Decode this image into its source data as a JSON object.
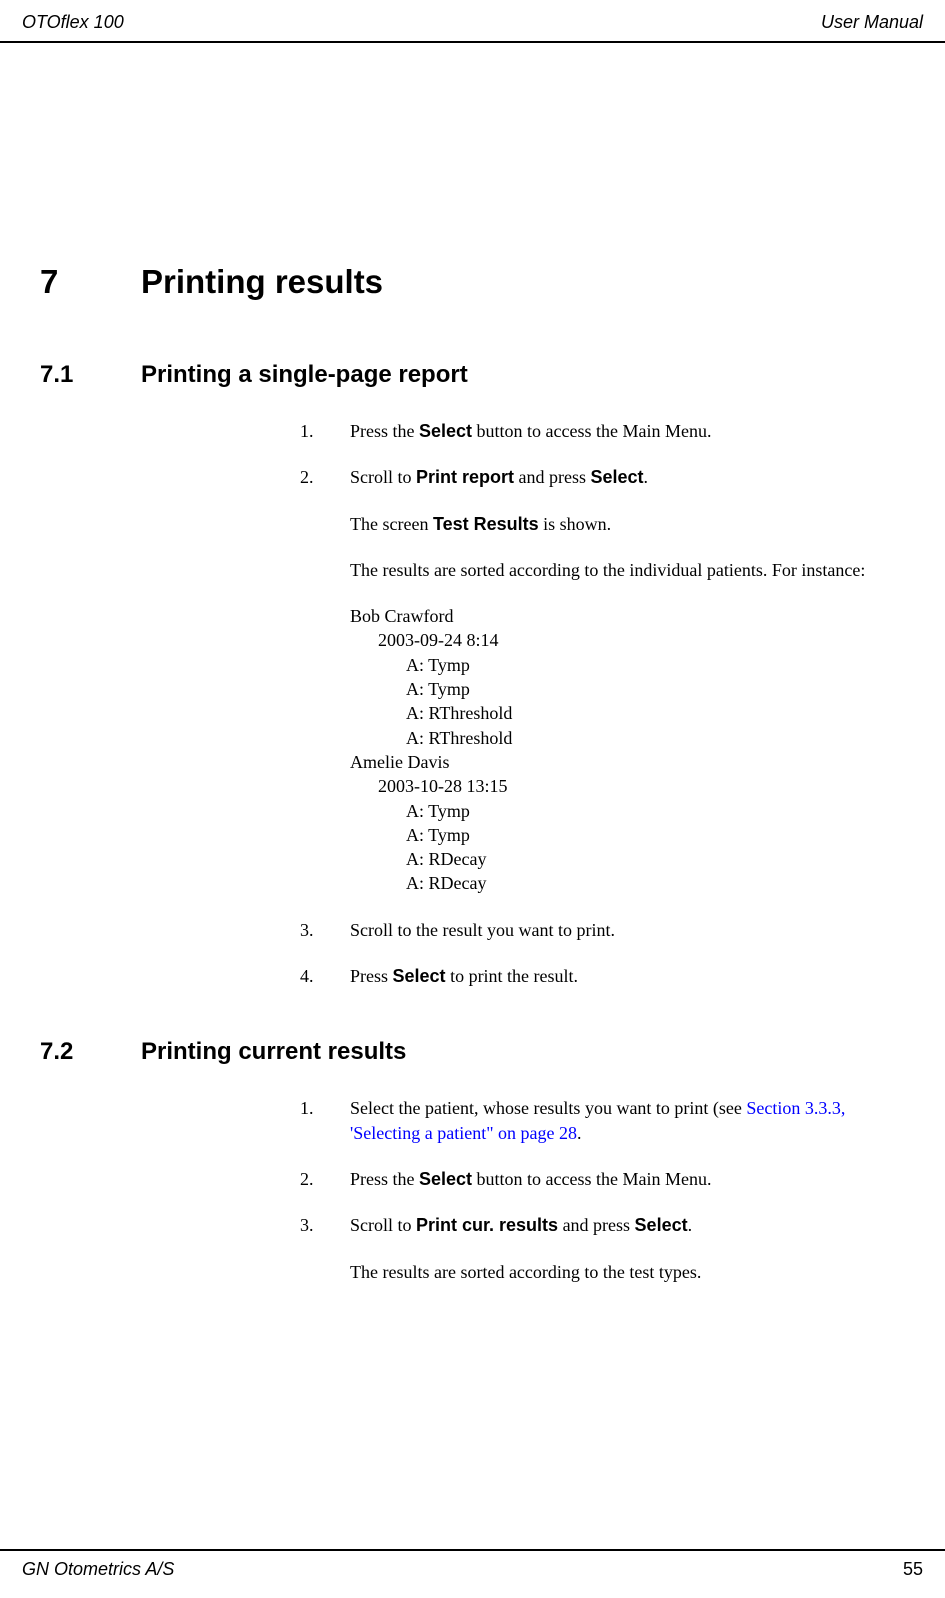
{
  "header": {
    "left": "OTOflex 100",
    "right": "User Manual"
  },
  "s7": {
    "num": "7",
    "title": "Printing results"
  },
  "s71": {
    "num": "7.1",
    "title": "Printing a single-page report",
    "step1": {
      "n": "1.",
      "pre": "Press the ",
      "b1": "Select",
      "post": " button to access the Main Menu."
    },
    "step2": {
      "n": "2.",
      "pre": "Scroll to ",
      "b1": "Print report",
      "mid": " and press ",
      "b2": "Select",
      "post": "."
    },
    "note1": {
      "pre": "The screen ",
      "b1": "Test Results",
      "post": " is shown."
    },
    "note2": "The results are sorted according to the individual patients. For instance:",
    "ex": {
      "p1_name": "Bob Crawford",
      "p1_dt": "2003-09-24 8:14",
      "p1_r1": "A: Tymp",
      "p1_r2": "A: Tymp",
      "p1_r3": "A: RThreshold",
      "p1_r4": "A: RThreshold",
      "p2_name": "Amelie Davis",
      "p2_dt": "2003-10-28 13:15",
      "p2_r1": "A: Tymp",
      "p2_r2": "A: Tymp",
      "p2_r3": "A: RDecay",
      "p2_r4": "A: RDecay"
    },
    "step3": {
      "n": "3.",
      "t": "Scroll to the result you want to print."
    },
    "step4": {
      "n": "4.",
      "pre": "Press ",
      "b1": "Select",
      "post": " to print the result."
    }
  },
  "s72": {
    "num": "7.2",
    "title": "Printing current results",
    "step1": {
      "n": "1.",
      "pre": "Select the patient, whose results you want to print (see ",
      "link": "Section 3.3.3, 'Selecting a patient\" on page 28",
      "post": "."
    },
    "step2": {
      "n": "2.",
      "pre": "Press the ",
      "b1": "Select",
      "post": " button to access the Main Menu."
    },
    "step3": {
      "n": "3.",
      "pre": "Scroll to ",
      "b1": "Print cur. results",
      "mid": " and press ",
      "b2": "Select",
      "post": "."
    },
    "note1": "The results are sorted according to the test types."
  },
  "footer": {
    "left": "GN Otometrics A/S",
    "right": "55"
  }
}
